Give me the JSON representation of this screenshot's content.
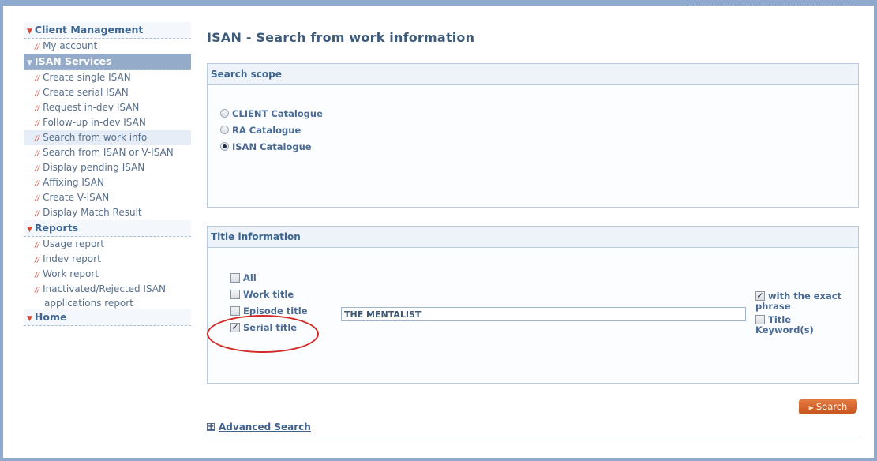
{
  "sidebar": {
    "sections": [
      {
        "label": "Client Management",
        "items": [
          "My account"
        ]
      },
      {
        "label": "ISAN Services",
        "items": [
          "Create single ISAN",
          "Create serial ISAN",
          "Request in-dev ISAN",
          "Follow-up in-dev ISAN",
          "Search from work info",
          "Search from ISAN or V-ISAN",
          "Display pending ISAN",
          "Affixing ISAN",
          "Create V-ISAN",
          "Display Match Result"
        ]
      },
      {
        "label": "Reports",
        "items": [
          "Usage report",
          "Indev report",
          "Work report",
          "Inactivated/Rejected ISAN",
          "applications report"
        ]
      },
      {
        "label": "Home",
        "items": []
      }
    ],
    "active_section": "ISAN Services",
    "selected_item": "Search from work info"
  },
  "page": {
    "title": "ISAN - Search from work information"
  },
  "search_scope": {
    "heading": "Search scope",
    "options": [
      "CLIENT Catalogue",
      "RA Catalogue",
      "ISAN Catalogue"
    ],
    "selected": "ISAN Catalogue"
  },
  "title_info": {
    "heading": "Title information",
    "checkboxes": [
      {
        "label": "All",
        "checked": false
      },
      {
        "label": "Work title",
        "checked": false
      },
      {
        "label": "Episode title",
        "checked": false
      },
      {
        "label": "Serial title",
        "checked": true
      }
    ],
    "input_value": "THE MENTALIST",
    "exact_phrase": {
      "line1": "with the exact",
      "line2": "phrase",
      "checked": true
    },
    "keyword": {
      "line1": "Title",
      "line2": "Keyword(s)",
      "checked": false
    }
  },
  "actions": {
    "search_label": "Search",
    "advanced_label": "Advanced Search"
  },
  "colors": {
    "accent": "#c9541f",
    "annotation": "#d22a26",
    "frame": "#8fa9cf"
  }
}
